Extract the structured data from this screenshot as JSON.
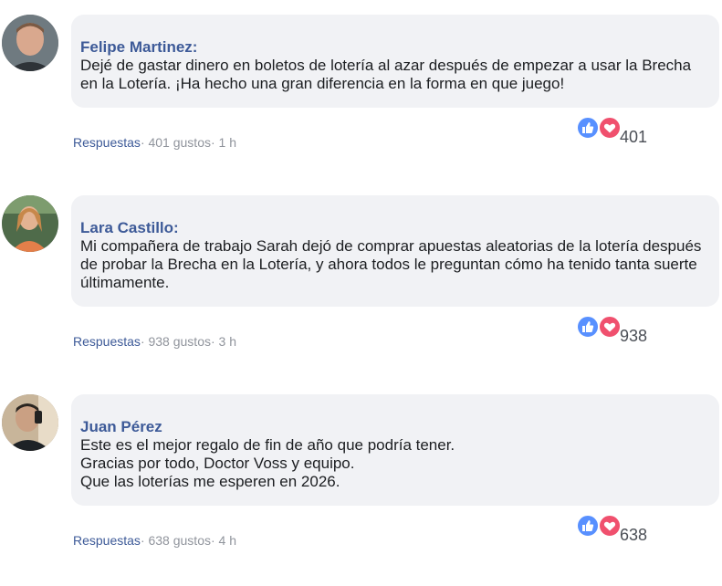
{
  "comments": [
    {
      "author": "Felipe Martinez:",
      "text": "Dejé de gastar dinero en boletos de lotería al azar después de empezar a usar la Brecha en la Lotería. ¡Ha hecho una gran diferencia en la forma en que juego!",
      "replies_label": "Respuestas",
      "likes_label": "· 401 gustos",
      "time_label": "· 1 h",
      "reaction_count": "401"
    },
    {
      "author": "Lara Castillo:",
      "text": "Mi compañera de trabajo Sarah dejó de comprar apuestas aleatorias de la lotería después de probar la Brecha en la Lotería, y ahora todos le preguntan cómo ha tenido tanta suerte últimamente.",
      "replies_label": "Respuestas",
      "likes_label": "· 938 gustos",
      "time_label": "· 3 h",
      "reaction_count": "938"
    },
    {
      "author": "Juan Pérez",
      "text": "Este es el mejor regalo de fin de año que podría tener.\nGracias por todo, Doctor Voss y equipo.\nQue las loterías me esperen en 2026.",
      "replies_label": "Respuestas",
      "likes_label": "· 638 gustos",
      "time_label": "· 4 h",
      "reaction_count": "638"
    }
  ],
  "colors": {
    "author": "#3d5a98",
    "bubble": "#f1f2f5",
    "like_icon": "#5890ff",
    "heart_icon": "#f0506e"
  },
  "icons": [
    "thumbs-up-icon",
    "heart-icon"
  ]
}
